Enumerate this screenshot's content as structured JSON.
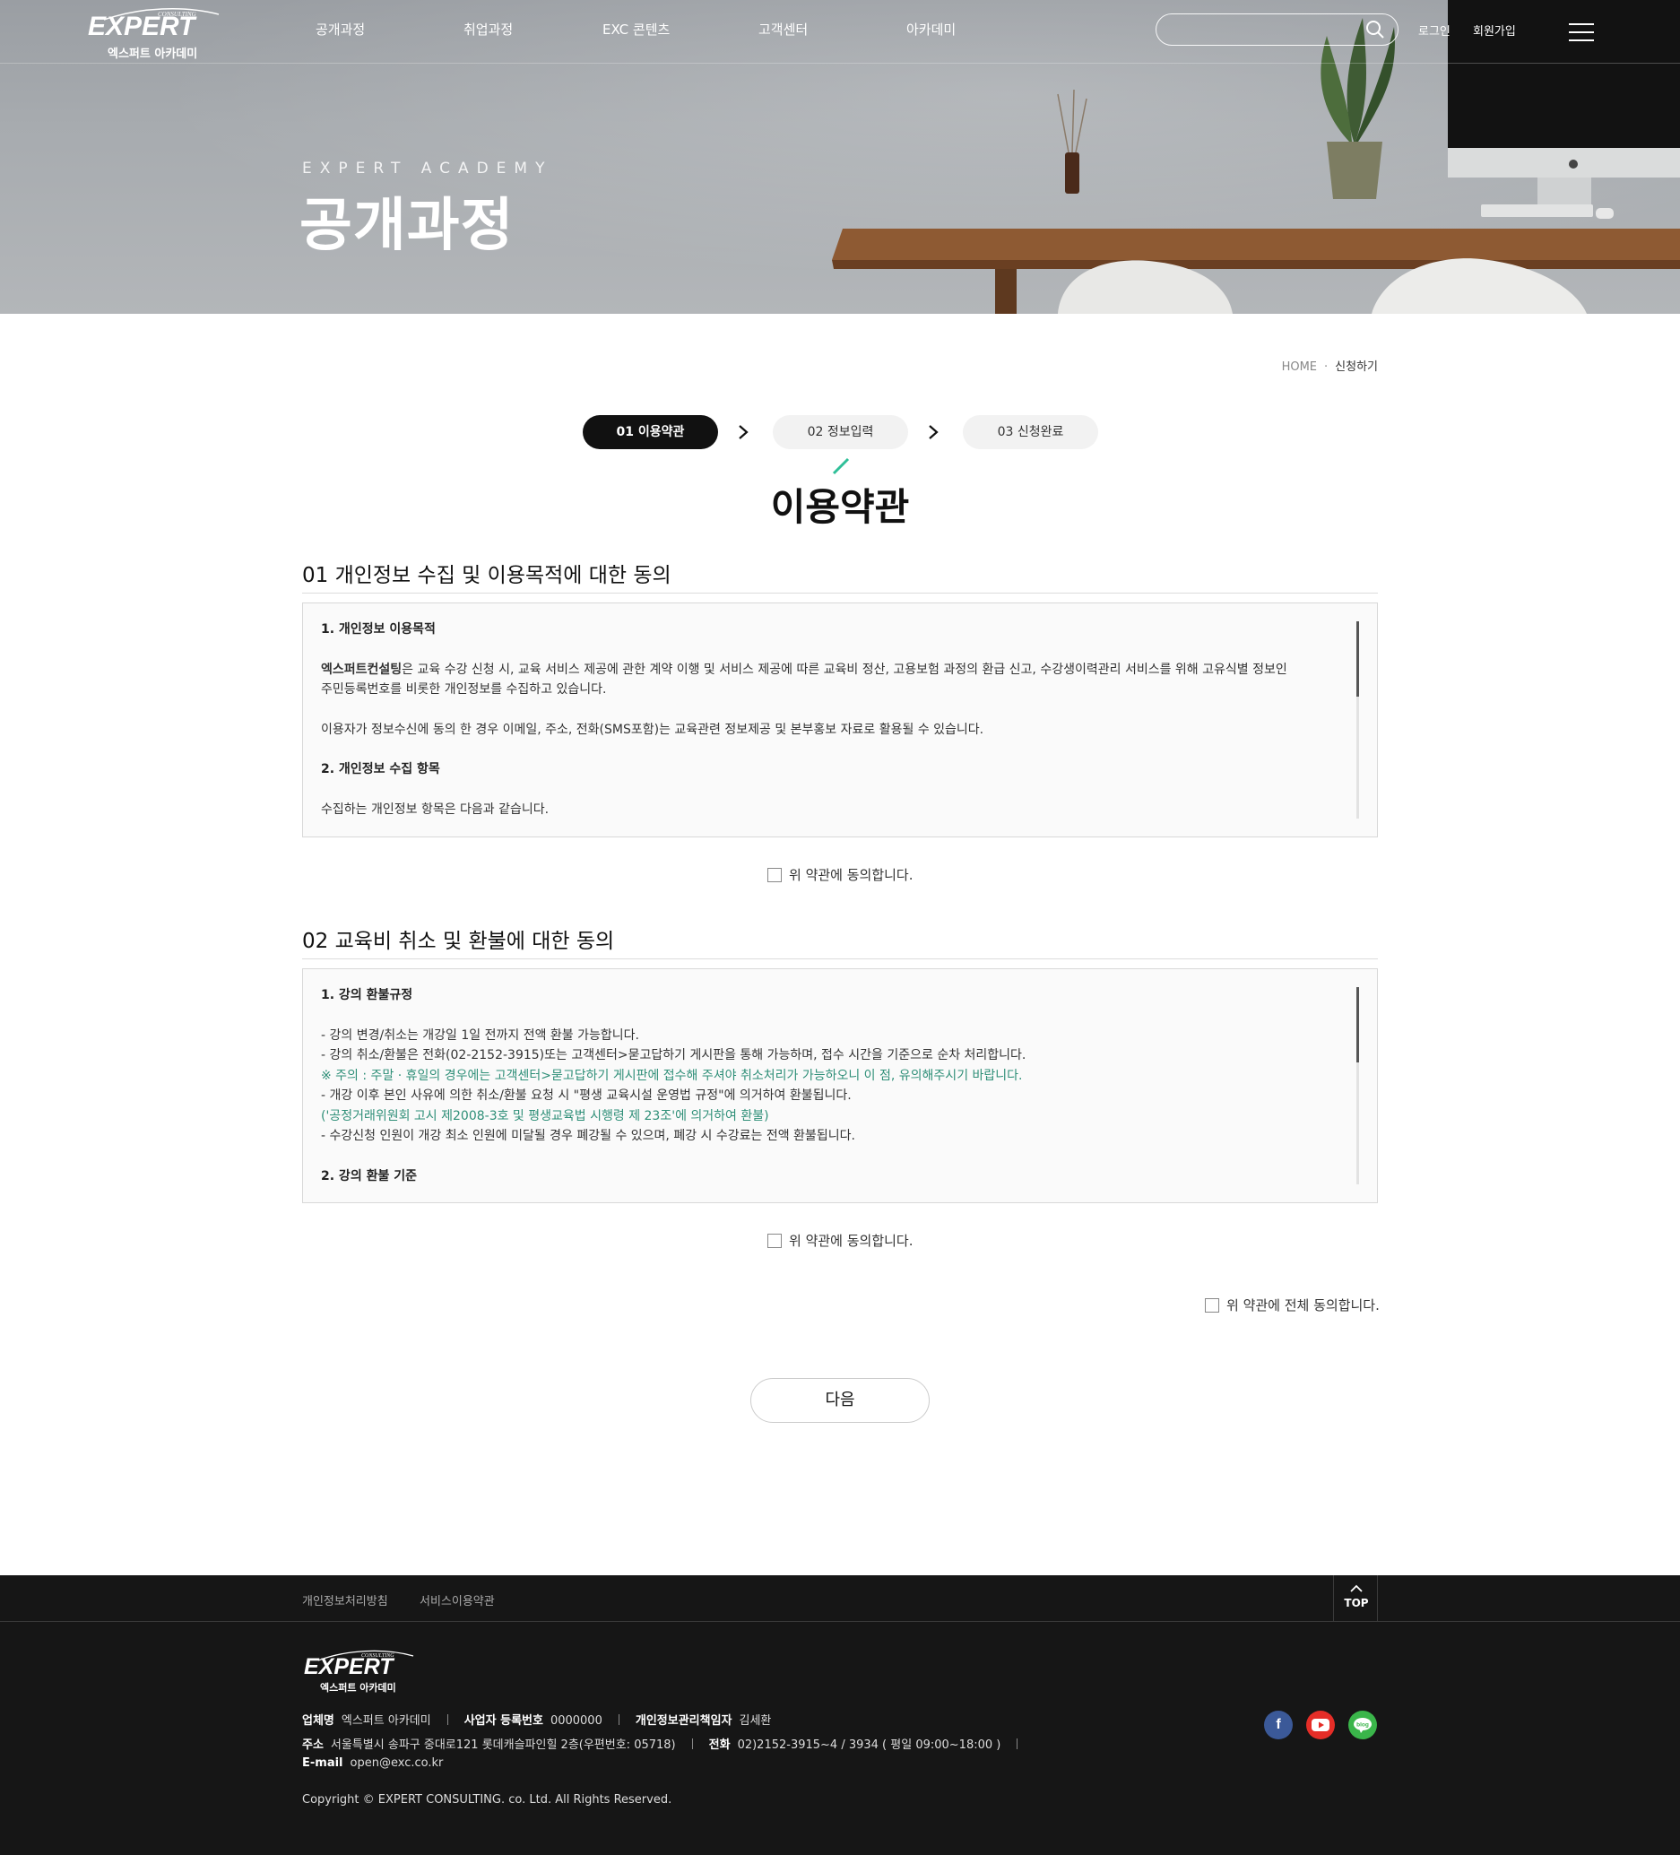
{
  "header": {
    "logo_text": "EXPERT",
    "logo_sub": "엑스퍼트 아카데미",
    "nav": [
      "공개과정",
      "취업과정",
      "EXC 콘텐츠",
      "고객센터",
      "아카데미"
    ],
    "search_placeholder": "",
    "login": "로그인",
    "signup": "회원가입"
  },
  "hero": {
    "subtitle": "EXPERT ACADEMY",
    "title": "공개과정"
  },
  "breadcrumb": {
    "home": "HOME",
    "separator": "·",
    "current": "신청하기"
  },
  "steps": [
    {
      "label": "01 이용약관",
      "active": true
    },
    {
      "label": "02 정보입력",
      "active": false
    },
    {
      "label": "03 신청완료",
      "active": false
    }
  ],
  "page_title": "이용약관",
  "sections": [
    {
      "title": "01 개인정보 수집 및 이용목적에 대한 동의",
      "p1_head": "1. 개인정보 이용목적",
      "p1_brand": "엑스퍼트컨설팅",
      "p1_line1": "은 교육 수강 신청 시, 교육 서비스 제공에 관한 계약 이행 및 서비스 제공에 따른 교육비 정산, 고용보험 과정의 환급 신고, 수강생이력관리 서비스를 위해 고유식별 정보인",
      "p1_line2": "주민등록번호를 비롯한 개인정보를 수집하고 있습니다.",
      "p1_line3": "이용자가 정보수신에 동의 한 경우 이메일, 주소, 전화(SMS포함)는 교육관련 정보제공 및 본부홍보 자료로 활용될 수 있습니다.",
      "p2_head": "2. 개인정보 수집 항목",
      "p2_line1": "수집하는 개인정보 항목은 다음과 같습니다.",
      "agree": "위 약관에 동의합니다."
    },
    {
      "title": "02 교육비 취소 및 환불에 대한 동의",
      "p1_head": "1. 강의 환불규정",
      "lines": [
        "- 강의 변경/취소는 개강일 1일 전까지 전액 환불 가능합니다.",
        "- 강의 취소/환불은 전화(02-2152-3915)또는 고객센터>묻고답하기 게시판을 통해 가능하며, 접수 시간을 기준으로 순차 처리합니다.",
        "※ 주의 : 주말 · 휴일의 경우에는 고객센터>묻고답하기 게시판에 접수해 주셔야 취소처리가 가능하오니 이 점, 유의해주시기 바랍니다.",
        "- 개강 이후 본인 사유에 의한 취소/환불 요청 시 \"평생 교육시설 운영법 규정\"에 의거하여 환불됩니다.",
        "('공정거래위원회 고시 제2008-3호 및 평생교육법 시행령 제 23조'에 의거하여 환불)",
        "- 수강신청 인원이 개강 최소 인원에 미달될 경우 폐강될 수 있으며, 폐강 시 수강료는 전액 환불됩니다."
      ],
      "p2_head": "2. 강의 환불 기준",
      "agree": "위 약관에 동의합니다."
    }
  ],
  "agree_all": "위 약관에 전체 동의합니다.",
  "next_button": "다음",
  "footer": {
    "links": [
      "개인정보처리방침",
      "서비스이용약관"
    ],
    "top_label": "TOP",
    "logo_sub": "엑스퍼트 아카데미",
    "company_label": "업체명",
    "company": "엑스퍼트 아카데미",
    "bizno_label": "사업자 등록번호",
    "bizno": "0000000",
    "privacy_label": "개인정보관리책임자",
    "privacy": "김세환",
    "address_label": "주소",
    "address": "서울특별시 송파구 중대로121 롯데캐슬파인힐 2층(우편번호: 05718)",
    "tel_label": "전화",
    "tel": "02)2152-3915~4 / 3934 ( 평일 09:00~18:00 )",
    "email_label": "E-mail",
    "email": "open@exc.co.kr",
    "copyright": "Copyright © EXPERT CONSULTING. co. Ltd. All Rights Reserved.",
    "sns": [
      "facebook-icon",
      "youtube-icon",
      "blog-icon"
    ]
  },
  "colors": {
    "accent_green": "#2fbf98",
    "note_green": "#2f8f78",
    "footer_bg": "#161616",
    "step_active": "#111111"
  }
}
